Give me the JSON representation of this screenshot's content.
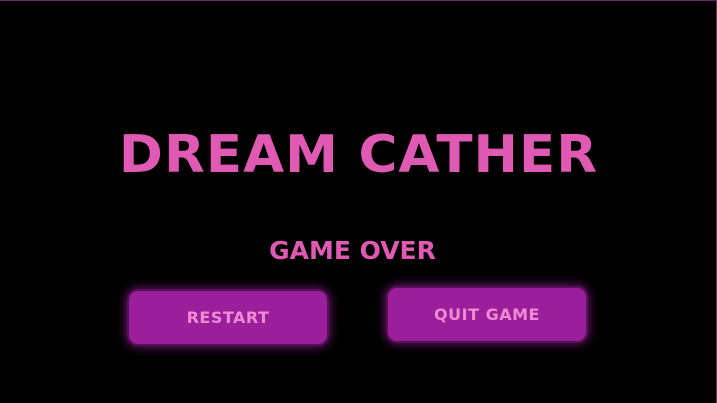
{
  "game": {
    "title": "DREAM CATHER",
    "status": "GAME OVER"
  },
  "buttons": {
    "restart_label": "RESTART",
    "quit_label": "QUIT GAME"
  },
  "colors": {
    "background": "#000000",
    "title_text": "#e05ab4",
    "button_fill": "#9b1f9b",
    "button_text": "#f08ad2"
  }
}
